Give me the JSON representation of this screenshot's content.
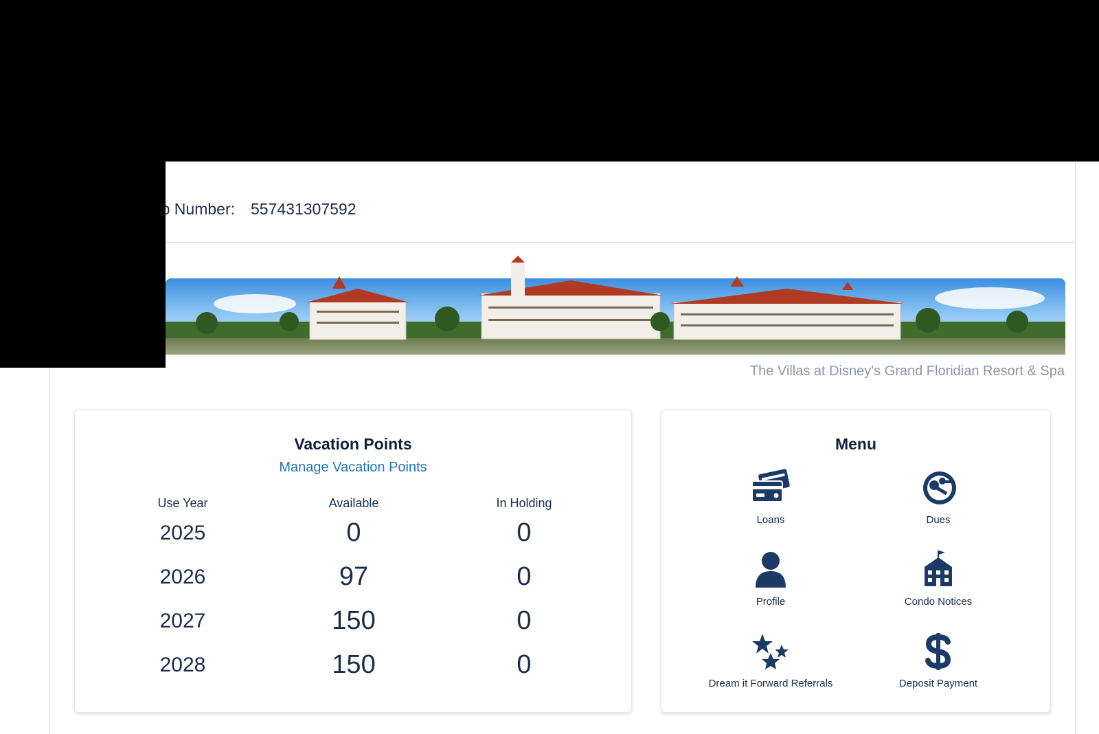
{
  "header": {
    "membership_label": "Membership Number:",
    "membership_number": "557431307592"
  },
  "resort": {
    "name": "The Villas at Disney's Grand Floridian Resort & Spa"
  },
  "points": {
    "title": "Vacation Points",
    "manage_link": "Manage Vacation Points",
    "columns": [
      "Use Year",
      "Available",
      "In Holding"
    ],
    "rows": [
      {
        "year": "2025",
        "available": "0",
        "holding": "0"
      },
      {
        "year": "2026",
        "available": "97",
        "holding": "0"
      },
      {
        "year": "2027",
        "available": "150",
        "holding": "0"
      },
      {
        "year": "2028",
        "available": "150",
        "holding": "0"
      }
    ]
  },
  "menu": {
    "title": "Menu",
    "items": [
      {
        "label": "Loans",
        "icon": "credit-cards-icon"
      },
      {
        "label": "Dues",
        "icon": "keys-icon"
      },
      {
        "label": "Profile",
        "icon": "person-icon"
      },
      {
        "label": "Condo Notices",
        "icon": "building-icon"
      },
      {
        "label": "Dream it Forward Referrals",
        "icon": "stars-icon"
      },
      {
        "label": "Deposit Payment",
        "icon": "dollar-sign-icon"
      }
    ]
  },
  "colors": {
    "navy": "#1b2c4b",
    "icon_blue": "#1c3a66",
    "link_blue": "#1f77b4",
    "muted_gray": "#8b96a6",
    "redaction": "#000000"
  }
}
